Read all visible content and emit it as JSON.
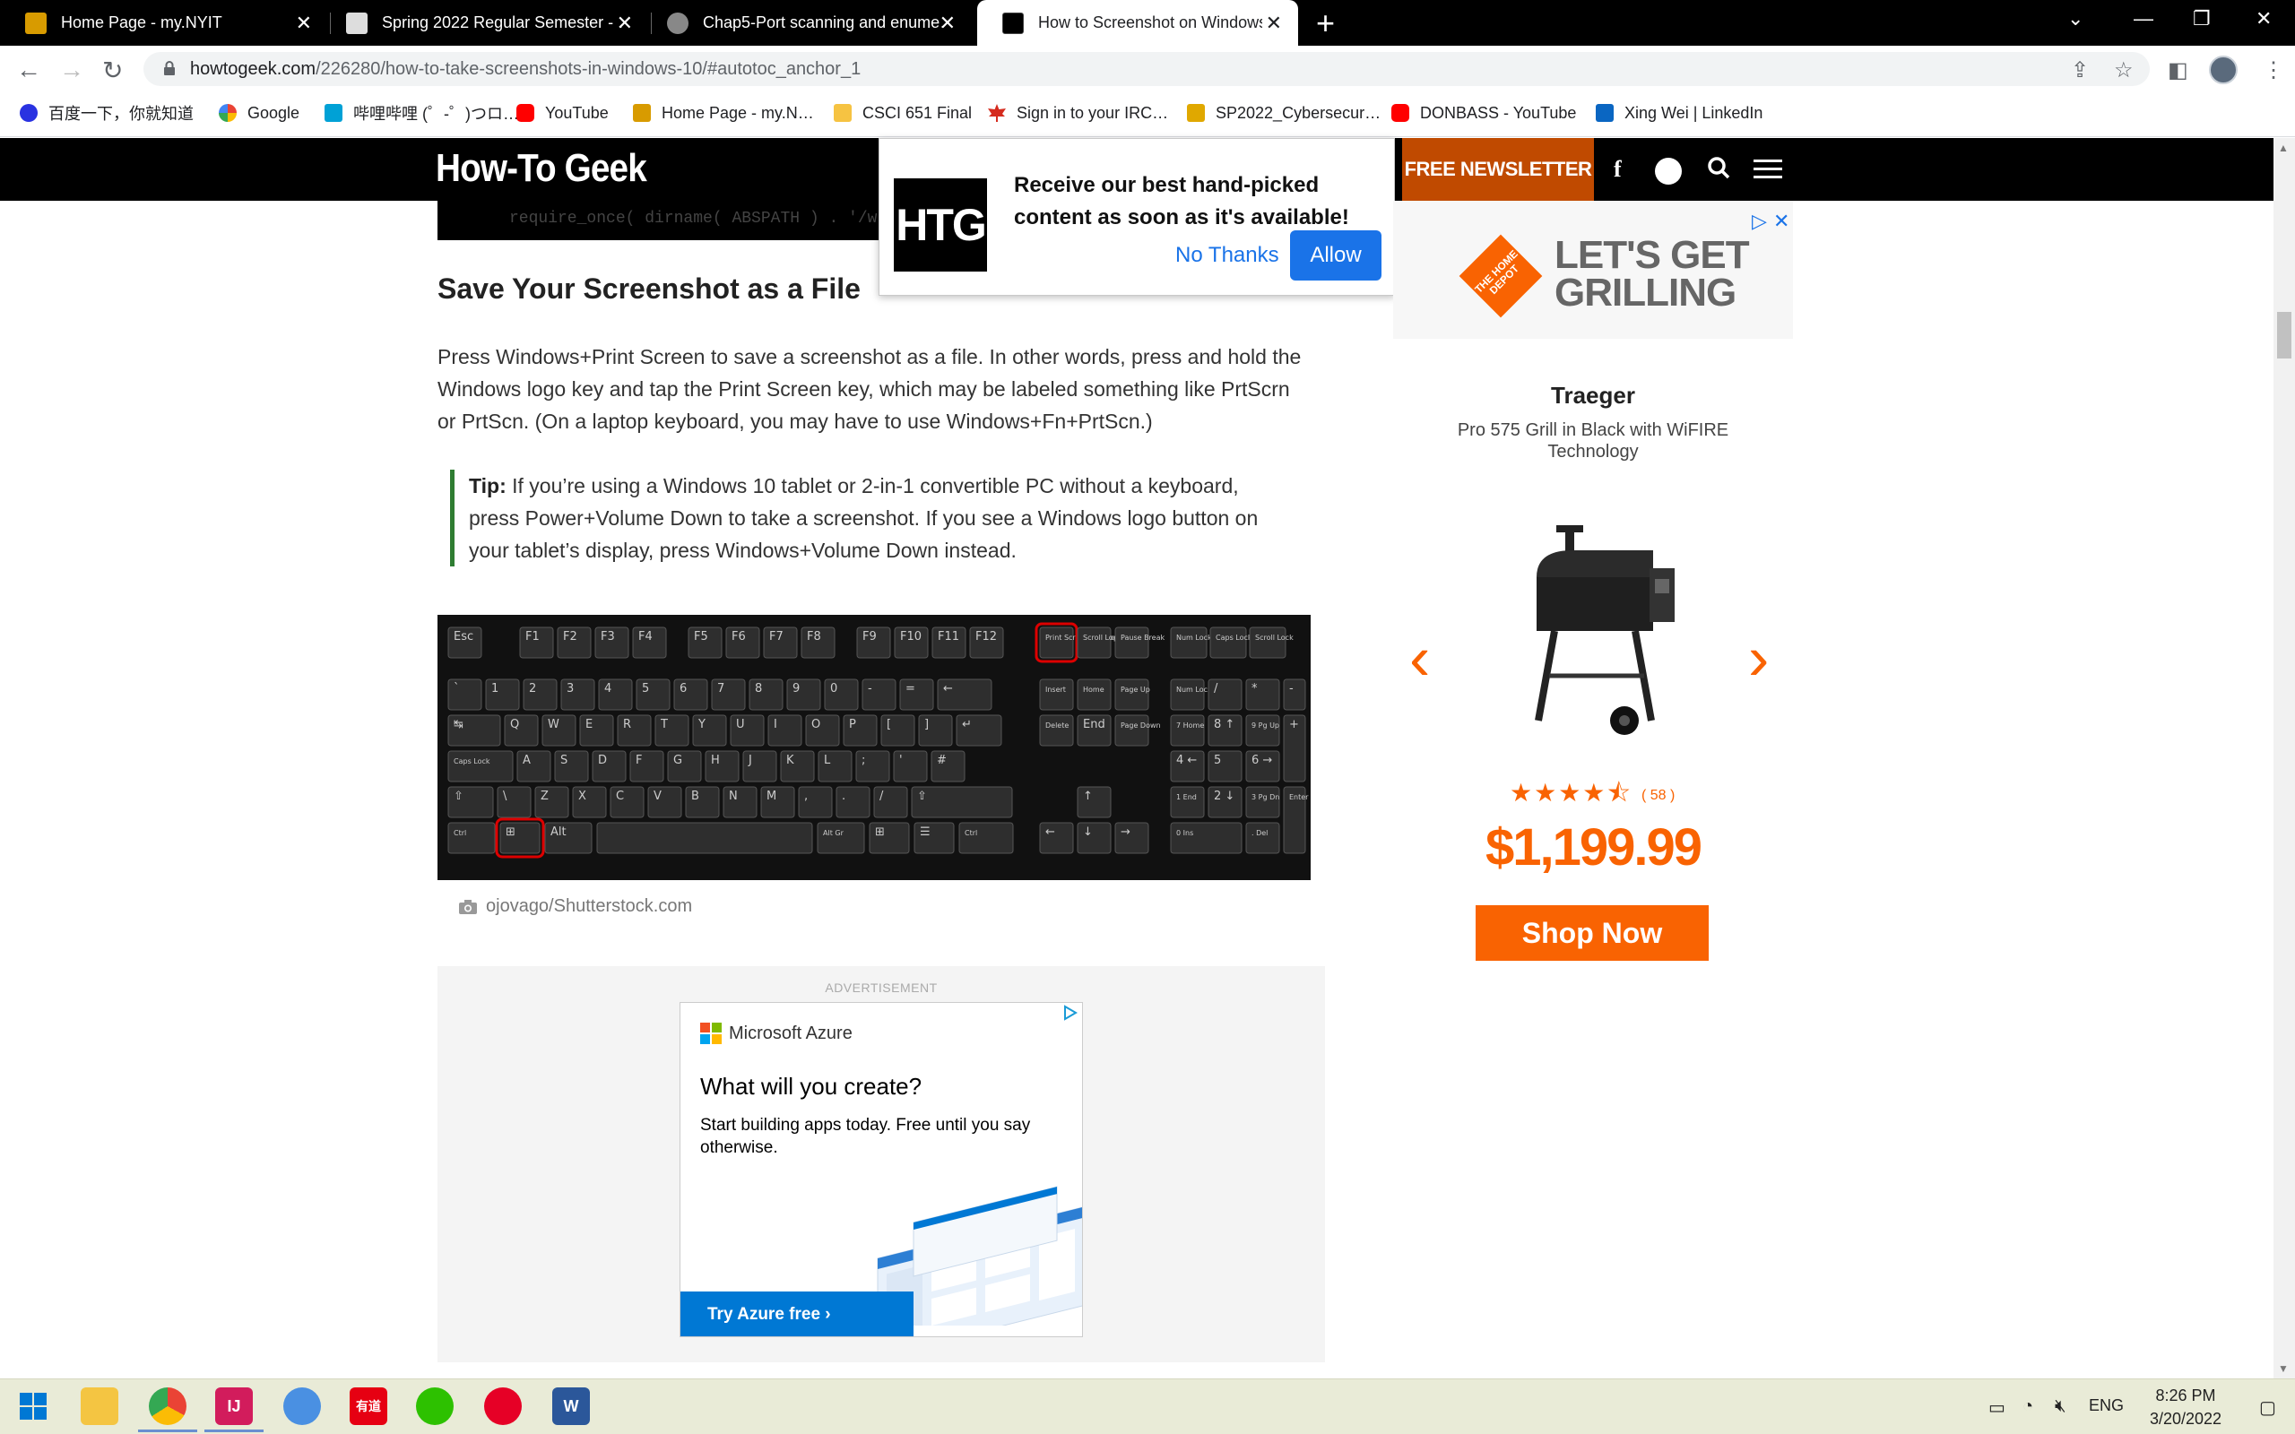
{
  "browser": {
    "tabs": [
      {
        "title": "Home Page - my.NYIT",
        "active": false
      },
      {
        "title": "Spring 2022 Regular Semester - …",
        "active": false
      },
      {
        "title": "Chap5-Port scanning and enume…",
        "active": false
      },
      {
        "title": "How to Screenshot on Windows…",
        "active": true
      }
    ],
    "url_host": "howtogeek.com",
    "url_path": "/226280/how-to-take-screenshots-in-windows-10/#autotoc_anchor_1",
    "bookmarks": [
      {
        "label": "百度一下，你就知道",
        "color": "#2932e1"
      },
      {
        "label": "Google",
        "color": "#4285f4"
      },
      {
        "label": "哔哩哔哩 (゜-゜)つロ…",
        "color": "#00a1d6"
      },
      {
        "label": "YouTube",
        "color": "#ff0000"
      },
      {
        "label": "Home Page - my.N…",
        "color": "#d89b00"
      },
      {
        "label": "CSCI 651 Final",
        "color": "#f6c342"
      },
      {
        "label": "Sign in to your IRC…",
        "color": "#d52b1e"
      },
      {
        "label": "SP2022_Cybersecur…",
        "color": "#e0a800"
      },
      {
        "label": "DONBASS - YouTube",
        "color": "#ff0000"
      },
      {
        "label": "Xing Wei | LinkedIn",
        "color": "#0a66c2"
      }
    ]
  },
  "site": {
    "logo": "How-To Geek",
    "newsletter": "FREE NEWSLETTER"
  },
  "popup": {
    "badge": "HTG",
    "message": "Receive our best hand-picked content as soon as it's available!",
    "no_thanks": "No Thanks",
    "allow": "Allow"
  },
  "article": {
    "code_snippet": "require_once( dirname( ABSPATH ) . '/w",
    "heading": "Save Your Screenshot as a File",
    "paragraph": "Press Windows+Print Screen to save a screenshot as a file. In other words, press and hold the Windows logo key and tap the Print Screen key, which may be labeled something like PrtScrn or PrtScn. (On a laptop keyboard, you may have to use Windows+Fn+PrtScn.)",
    "tip_label": "Tip:",
    "tip_text": " If you’re using a Windows 10 tablet or 2-in-1 convertible PC without a keyboard, press Power+Volume Down to take a screenshot. If you see a Windows logo button on your tablet’s display, press Windows+Volume Down instead.",
    "image_credit": "ojovago/Shutterstock.com"
  },
  "keyboard": {
    "fn_row": [
      "Esc",
      "F1",
      "F2",
      "F3",
      "F4",
      "F5",
      "F6",
      "F7",
      "F8",
      "F9",
      "F10",
      "F11",
      "F12"
    ],
    "sys_keys": [
      "Print Screen Sys Rq",
      "Scroll Lock",
      "Pause Break"
    ],
    "locks": [
      "Num Lock",
      "Caps Lock",
      "Scroll Lock"
    ],
    "row1": [
      "`",
      "1",
      "2",
      "3",
      "4",
      "5",
      "6",
      "7",
      "8",
      "9",
      "0",
      "-",
      "=",
      "←"
    ],
    "row2": [
      "↹",
      "Q",
      "W",
      "E",
      "R",
      "T",
      "Y",
      "U",
      "I",
      "O",
      "P",
      "[",
      "]",
      "↵"
    ],
    "row3": [
      "Caps Lock",
      "A",
      "S",
      "D",
      "F",
      "G",
      "H",
      "J",
      "K",
      "L",
      ";",
      "'",
      "#"
    ],
    "row4": [
      "⇧",
      "\\",
      "Z",
      "X",
      "C",
      "V",
      "B",
      "N",
      "M",
      ",",
      ".",
      "/",
      "⇧"
    ],
    "row5": [
      "Ctrl",
      "⊞",
      "Alt",
      "",
      "Alt Gr",
      "⊞",
      "☰",
      "Ctrl"
    ],
    "nav1": [
      "Insert",
      "Home",
      "Page Up"
    ],
    "nav2": [
      "Delete",
      "End",
      "Page Down"
    ],
    "arrows": [
      "↑",
      "←",
      "↓",
      "→"
    ],
    "numpad": [
      "Num Lock",
      "/",
      "*",
      "-",
      "7 Home",
      "8 ↑",
      "9 Pg Up",
      "+",
      "4 ←",
      "5",
      "6 →",
      "1 End",
      "2 ↓",
      "3 Pg Dn",
      "Enter",
      "0 Ins",
      ". Del"
    ]
  },
  "ad_inline": {
    "label": "ADVERTISEMENT",
    "brand": "Microsoft Azure",
    "headline": "What will you create?",
    "body": "Start building apps today. Free until you say otherwise.",
    "cta": "Try Azure free ›"
  },
  "ad_side": {
    "banner_logo": "THE HOME DEPOT",
    "banner_text": "LET'S GET GRILLING",
    "product_brand": "Traeger",
    "product_name": "Pro 575 Grill in Black with WiFIRE Technology",
    "rating": 4.5,
    "rating_count": "( 58 )",
    "price": "$1,199.99",
    "cta": "Shop Now",
    "accent": "#f96302"
  },
  "taskbar": {
    "apps": [
      {
        "name": "windows-start",
        "color": "#0078d4"
      },
      {
        "name": "file-explorer",
        "color": "#f4c542"
      },
      {
        "name": "chrome",
        "color": "#ea4335"
      },
      {
        "name": "intellij",
        "color": "#d21c5c"
      },
      {
        "name": "browser-app",
        "color": "#4a90e2"
      },
      {
        "name": "youdao",
        "color": "#e60012"
      },
      {
        "name": "wechat",
        "color": "#2dc100"
      },
      {
        "name": "netease-music",
        "color": "#e60026"
      },
      {
        "name": "word",
        "color": "#2b579a"
      }
    ],
    "lang": "ENG",
    "time": "8:26 PM",
    "date": "3/20/2022"
  }
}
